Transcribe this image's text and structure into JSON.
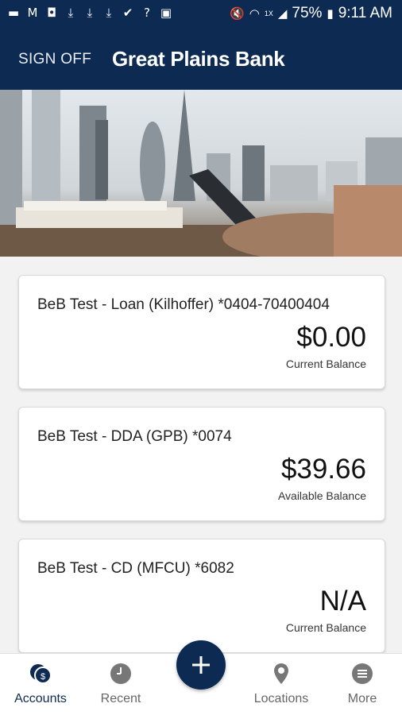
{
  "status_bar": {
    "battery": "75%",
    "time": "9:11 AM",
    "network": "1X",
    "left_icons": [
      "message-icon",
      "gmail-icon",
      "save-icon",
      "download-icon",
      "download-icon",
      "download-icon",
      "check-icon",
      "help-icon",
      "image-icon"
    ],
    "right_icons": [
      "mute-icon",
      "wifi-icon",
      "signal-icon",
      "battery-icon"
    ]
  },
  "header": {
    "sign_off": "SIGN OFF",
    "brand": "Great Plains Bank"
  },
  "accounts": [
    {
      "name": "BeB Test - Loan (Kilhoffer) *0404-70400404",
      "amount": "$0.00",
      "label": "Current Balance"
    },
    {
      "name": "BeB Test - DDA (GPB) *0074",
      "amount": "$39.66",
      "label": "Available Balance"
    },
    {
      "name": "BeB Test - CD (MFCU) *6082",
      "amount": "N/A",
      "label": "Current Balance"
    }
  ],
  "nav": {
    "accounts": "Accounts",
    "recent": "Recent",
    "locations": "Locations",
    "more": "More",
    "fab_icon": "plus-icon"
  },
  "colors": {
    "primary": "#0d2a52",
    "background": "#f2f2f2",
    "nav_inactive": "#666666"
  }
}
